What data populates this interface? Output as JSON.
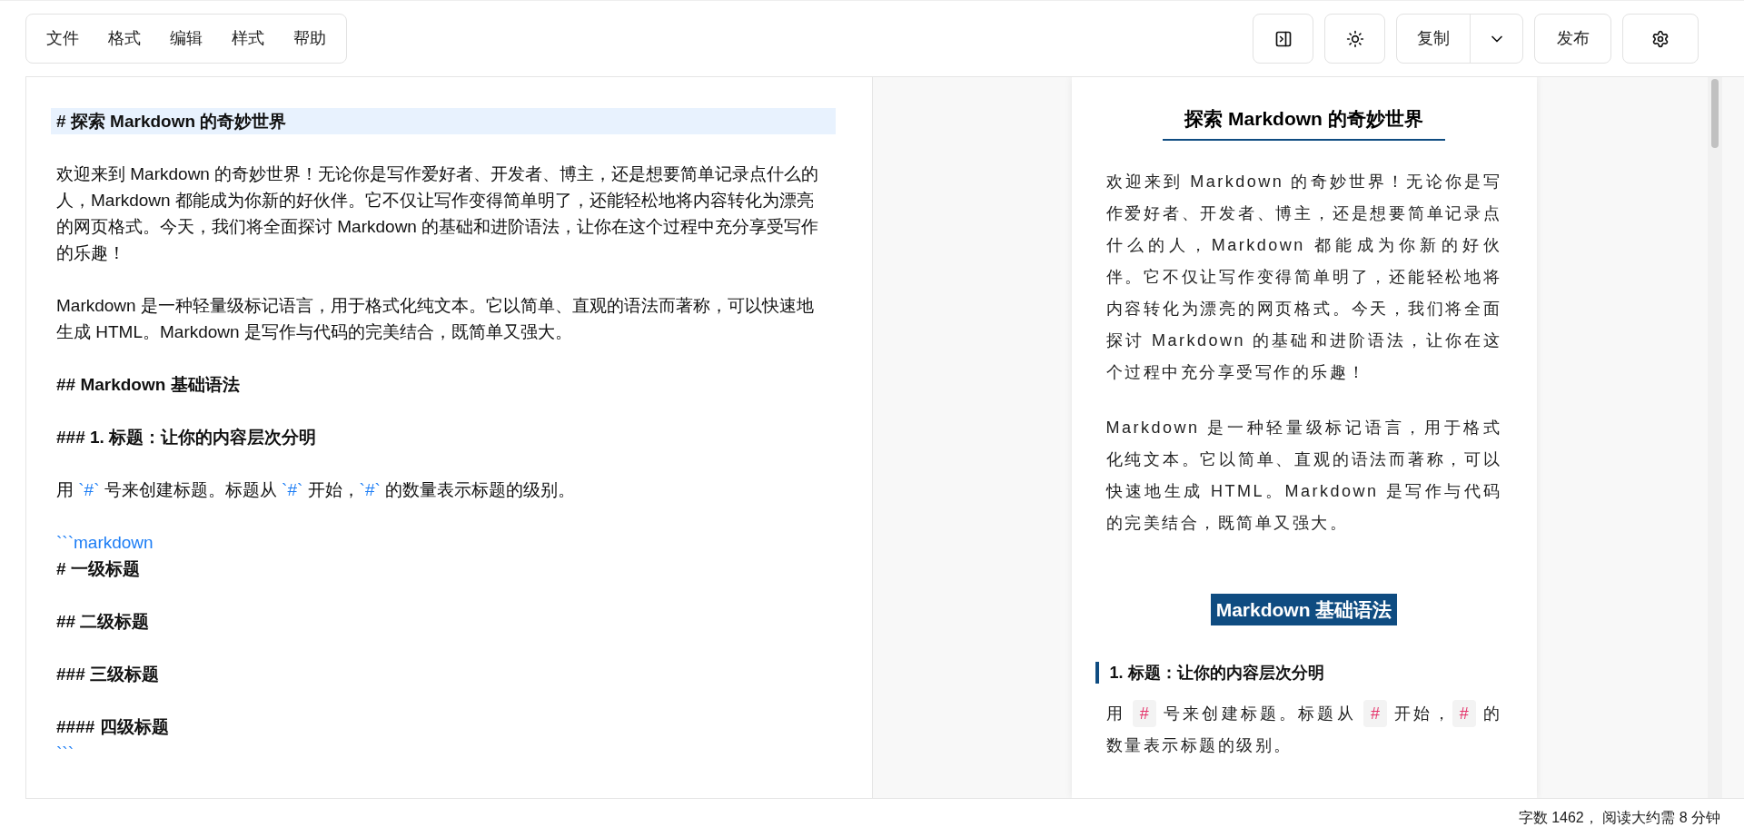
{
  "menu": [
    "文件",
    "格式",
    "编辑",
    "样式",
    "帮助"
  ],
  "toolbar": {
    "copy": "复制",
    "publish": "发布"
  },
  "editor": {
    "lines": [
      {
        "kind": "heading",
        "text": "# 探索 Markdown 的奇妙世界",
        "active": true
      },
      {
        "kind": "text",
        "parts": [
          {
            "kind": "plain",
            "text": "欢迎来到 Markdown 的奇妙世界！无论你是写作爱好者、开发者、博主，还是想要简单记录点什么的人，Markdown 都能成为你新的好伙伴。它不仅让写作变得简单明了，还能轻松地将内容转化为漂亮的网页格式。今天，我们将全面探讨 Markdown 的基础和进阶语法，让你在这个过程中充分享受写作的乐趣！"
          }
        ],
        "active": false
      },
      {
        "kind": "text",
        "parts": [
          {
            "kind": "plain",
            "text": "Markdown 是一种轻量级标记语言，用于格式化纯文本。它以简单、直观的语法而著称，可以快速地生成 HTML。Markdown 是写作与代码的完美结合，既简单又强大。"
          }
        ],
        "active": false
      },
      {
        "kind": "heading",
        "text": "## Markdown 基础语法",
        "active": false
      },
      {
        "kind": "heading",
        "text": "### 1. 标题：让你的内容层次分明",
        "active": false
      },
      {
        "kind": "text",
        "parts": [
          {
            "kind": "plain",
            "text": "用 "
          },
          {
            "kind": "code",
            "text": "`#`"
          },
          {
            "kind": "plain",
            "text": " 号来创建标题。标题从 "
          },
          {
            "kind": "code",
            "text": "`#`"
          },
          {
            "kind": "plain",
            "text": " 开始，"
          },
          {
            "kind": "code",
            "text": "`#`"
          },
          {
            "kind": "plain",
            "text": " 的数量表示标题的级别。"
          }
        ],
        "active": false
      },
      {
        "kind": "fence_open",
        "text": "```markdown",
        "active": false
      },
      {
        "kind": "heading",
        "text": "# 一级标题",
        "active": false
      },
      {
        "kind": "heading",
        "text": "## 二级标题",
        "active": false
      },
      {
        "kind": "heading",
        "text": "### 三级标题",
        "active": false
      },
      {
        "kind": "heading",
        "text": "#### 四级标题",
        "active": false
      },
      {
        "kind": "fence_close",
        "text": "```",
        "active": false
      }
    ]
  },
  "preview": {
    "blocks": [
      {
        "kind": "h1",
        "text": "探索 Markdown 的奇妙世界"
      },
      {
        "kind": "p",
        "parts": [
          {
            "kind": "plain",
            "text": "欢迎来到 Markdown 的奇妙世界！无论你是写作爱好者、开发者、博主，还是想要简单记录点什么的人，Markdown 都能成为你新的好伙伴。它不仅让写作变得简单明了，还能轻松地将内容转化为漂亮的网页格式。今天，我们将全面探讨 Markdown 的基础和进阶语法，让你在这个过程中充分享受写作的乐趣！"
          }
        ]
      },
      {
        "kind": "p",
        "parts": [
          {
            "kind": "plain",
            "text": "Markdown 是一种轻量级标记语言，用于格式化纯文本。它以简单、直观的语法而著称，可以快速地生成 HTML。Markdown 是写作与代码的完美结合，既简单又强大。"
          }
        ]
      },
      {
        "kind": "h2",
        "text": "Markdown 基础语法"
      },
      {
        "kind": "h3",
        "text": "1. 标题：让你的内容层次分明"
      },
      {
        "kind": "p",
        "parts": [
          {
            "kind": "plain",
            "text": "用 "
          },
          {
            "kind": "code",
            "text": "#"
          },
          {
            "kind": "plain",
            "text": " 号来创建标题。标题从 "
          },
          {
            "kind": "code",
            "text": "#"
          },
          {
            "kind": "plain",
            "text": " 开始，"
          },
          {
            "kind": "code",
            "text": "#"
          },
          {
            "kind": "plain",
            "text": " 的数量表示标题的级别。"
          }
        ]
      }
    ]
  },
  "status": "字数 1462， 阅读大约需 8 分钟"
}
